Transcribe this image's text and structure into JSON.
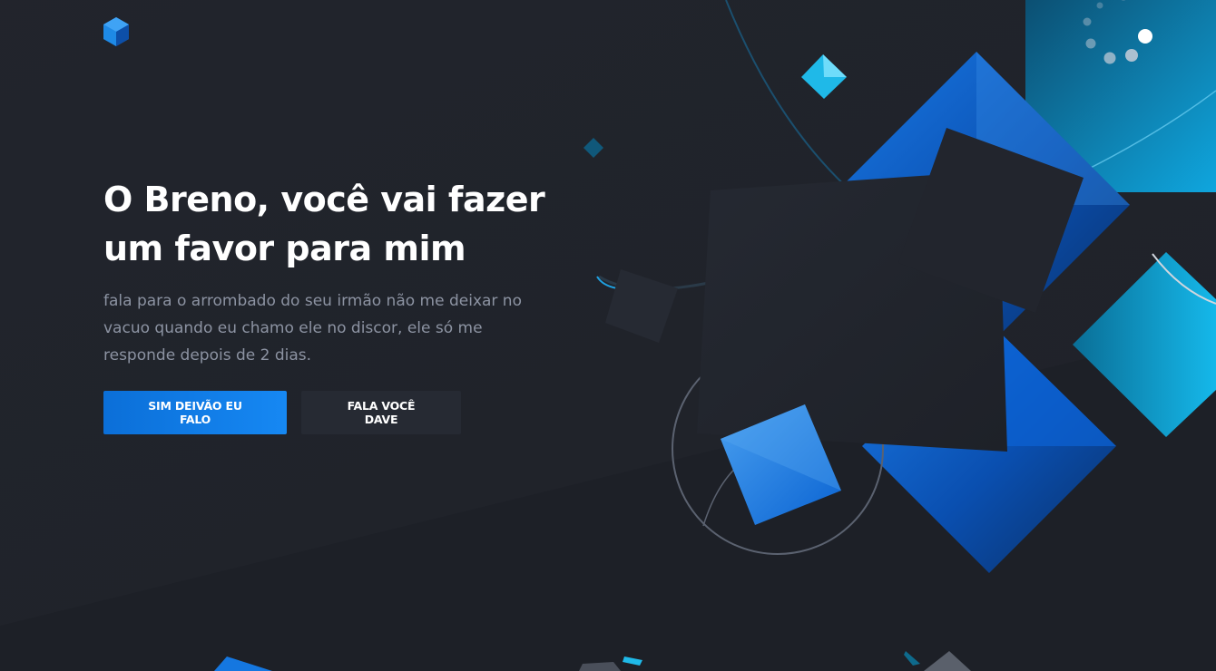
{
  "brand": {
    "logo_icon": "hexagon-cube-logo-icon",
    "accent": "#1688f3"
  },
  "hero": {
    "title": "O Breno, você vai fazer um favor para mim",
    "text": "fala para o arrombado do seu irmão não me deixar no vacuo quando eu chamo ele no discor, ele só me responde depois de 2 dias."
  },
  "actions": {
    "primary_label": "Sim deivão eu falo",
    "secondary_label": "Fala você Dave"
  },
  "colors": {
    "background": "#1d2027",
    "title": "#ffffff",
    "text": "#8c93a2",
    "primary": "#0b6fd8",
    "secondary": "#262a33",
    "cyan": "#1fb9e8"
  }
}
